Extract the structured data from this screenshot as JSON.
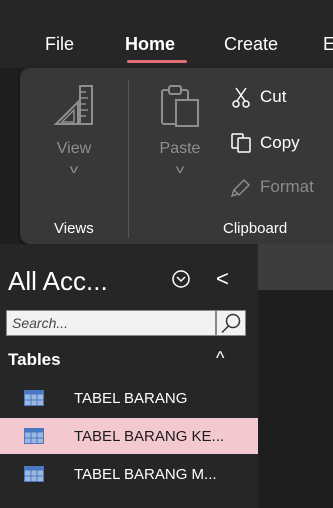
{
  "ribbon": {
    "tabs": [
      {
        "label": "File"
      },
      {
        "label": "Home"
      },
      {
        "label": "Create"
      },
      {
        "label": "E"
      }
    ],
    "active_tab": "Home",
    "accent_color": "#e06f7a",
    "groups": {
      "views": {
        "label": "Views",
        "view_button": {
          "label": "View",
          "icon": "view-icon",
          "enabled": false
        }
      },
      "clipboard": {
        "label": "Clipboard",
        "paste": {
          "label": "Paste",
          "icon": "paste-icon",
          "enabled": false
        },
        "cut": {
          "label": "Cut",
          "icon": "scissors-icon",
          "enabled": true
        },
        "copy": {
          "label": "Copy",
          "icon": "copy-icon",
          "enabled": true
        },
        "format": {
          "label": "Format",
          "icon": "format-painter-icon",
          "enabled": false
        }
      }
    }
  },
  "nav_pane": {
    "title": "All Acc...",
    "search": {
      "placeholder": "Search...",
      "value": ""
    },
    "section": {
      "label": "Tables",
      "toggle": "^"
    },
    "items": [
      {
        "label": "TABEL BARANG",
        "icon": "table-icon",
        "selected": false
      },
      {
        "label": "TABEL BARANG KE...",
        "icon": "table-icon",
        "selected": true
      },
      {
        "label": "TABEL BARANG M...",
        "icon": "table-icon",
        "selected": false
      }
    ],
    "selected_color": "#f3c9cf"
  }
}
